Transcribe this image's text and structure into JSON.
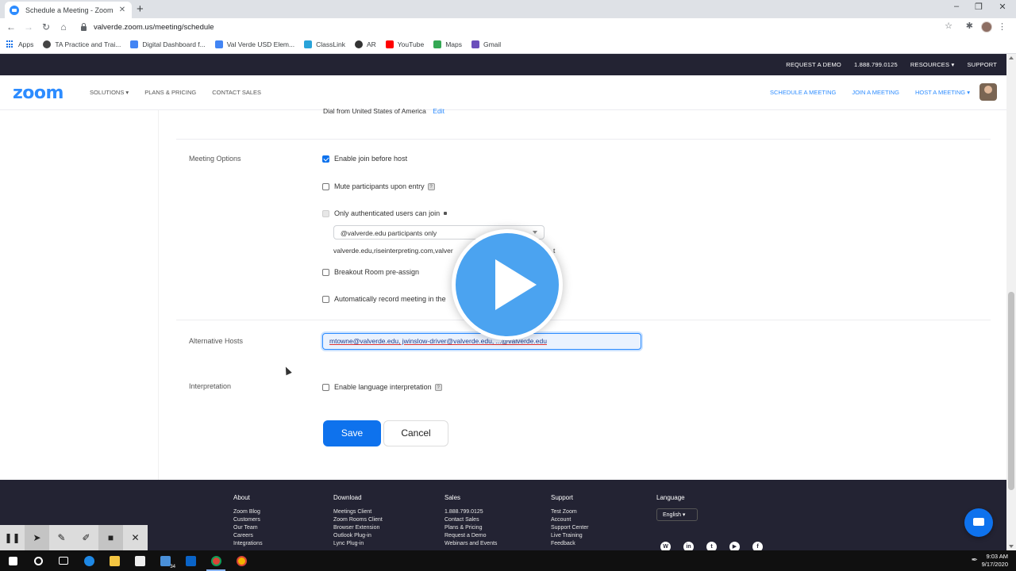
{
  "browser": {
    "tab_title": "Schedule a Meeting - Zoom",
    "url": "valverde.zoom.us/meeting/schedule",
    "bookmarks": [
      "Apps",
      "TA Practice and Trai...",
      "Digital Dashboard f...",
      "Val Verde USD Elem...",
      "ClassLink",
      "AR",
      "YouTube",
      "Maps",
      "Gmail"
    ]
  },
  "zoom_topbar": {
    "request_demo": "REQUEST A DEMO",
    "phone": "1.888.799.0125",
    "resources": "RESOURCES ▾",
    "support": "SUPPORT"
  },
  "zoom_nav": {
    "logo": "zoom",
    "solutions": "SOLUTIONS ▾",
    "plans": "PLANS & PRICING",
    "contact": "CONTACT SALES",
    "schedule": "SCHEDULE A MEETING",
    "join": "JOIN A MEETING",
    "host": "HOST A MEETING ▾"
  },
  "form": {
    "dial_text": "Dial from United States of America",
    "dial_edit": "Edit",
    "meeting_options_label": "Meeting Options",
    "opt_join_before_host": "Enable join before host",
    "opt_mute": "Mute participants upon entry",
    "opt_authenticated": "Only authenticated users can join",
    "auth_dropdown": "@valverde.edu participants only",
    "auth_domains": "valverde.edu,riseinterpreting.com,valver",
    "auth_domains_trailing": "t",
    "opt_breakout": "Breakout Room pre-assign",
    "opt_record": "Automatically record meeting in the",
    "alt_hosts_label": "Alternative Hosts",
    "alt_hosts_value": "mtowne@valverde.edu, jwinslow-driver@valverde.edu, ...@valverde.edu",
    "interpretation_label": "Interpretation",
    "opt_interpretation": "Enable language interpretation",
    "save": "Save",
    "cancel": "Cancel"
  },
  "footer": {
    "about": {
      "title": "About",
      "links": [
        "Zoom Blog",
        "Customers",
        "Our Team",
        "Careers",
        "Integrations"
      ]
    },
    "download": {
      "title": "Download",
      "links": [
        "Meetings Client",
        "Zoom Rooms Client",
        "Browser Extension",
        "Outlook Plug-in",
        "Lync Plug-in"
      ]
    },
    "sales": {
      "title": "Sales",
      "links": [
        "1.888.799.0125",
        "Contact Sales",
        "Plans & Pricing",
        "Request a Demo",
        "Webinars and Events"
      ]
    },
    "support": {
      "title": "Support",
      "links": [
        "Test Zoom",
        "Account",
        "Support Center",
        "Live Training",
        "Feedback"
      ]
    },
    "language": {
      "title": "Language",
      "value": "English ▾"
    }
  },
  "taskbar": {
    "outlook_badge": "34",
    "time": "9:03 AM",
    "date": "9/17/2020"
  },
  "colors": {
    "zoom_blue": "#2d8cff",
    "save_blue": "#0e72ed",
    "dark_bar": "#232333"
  }
}
